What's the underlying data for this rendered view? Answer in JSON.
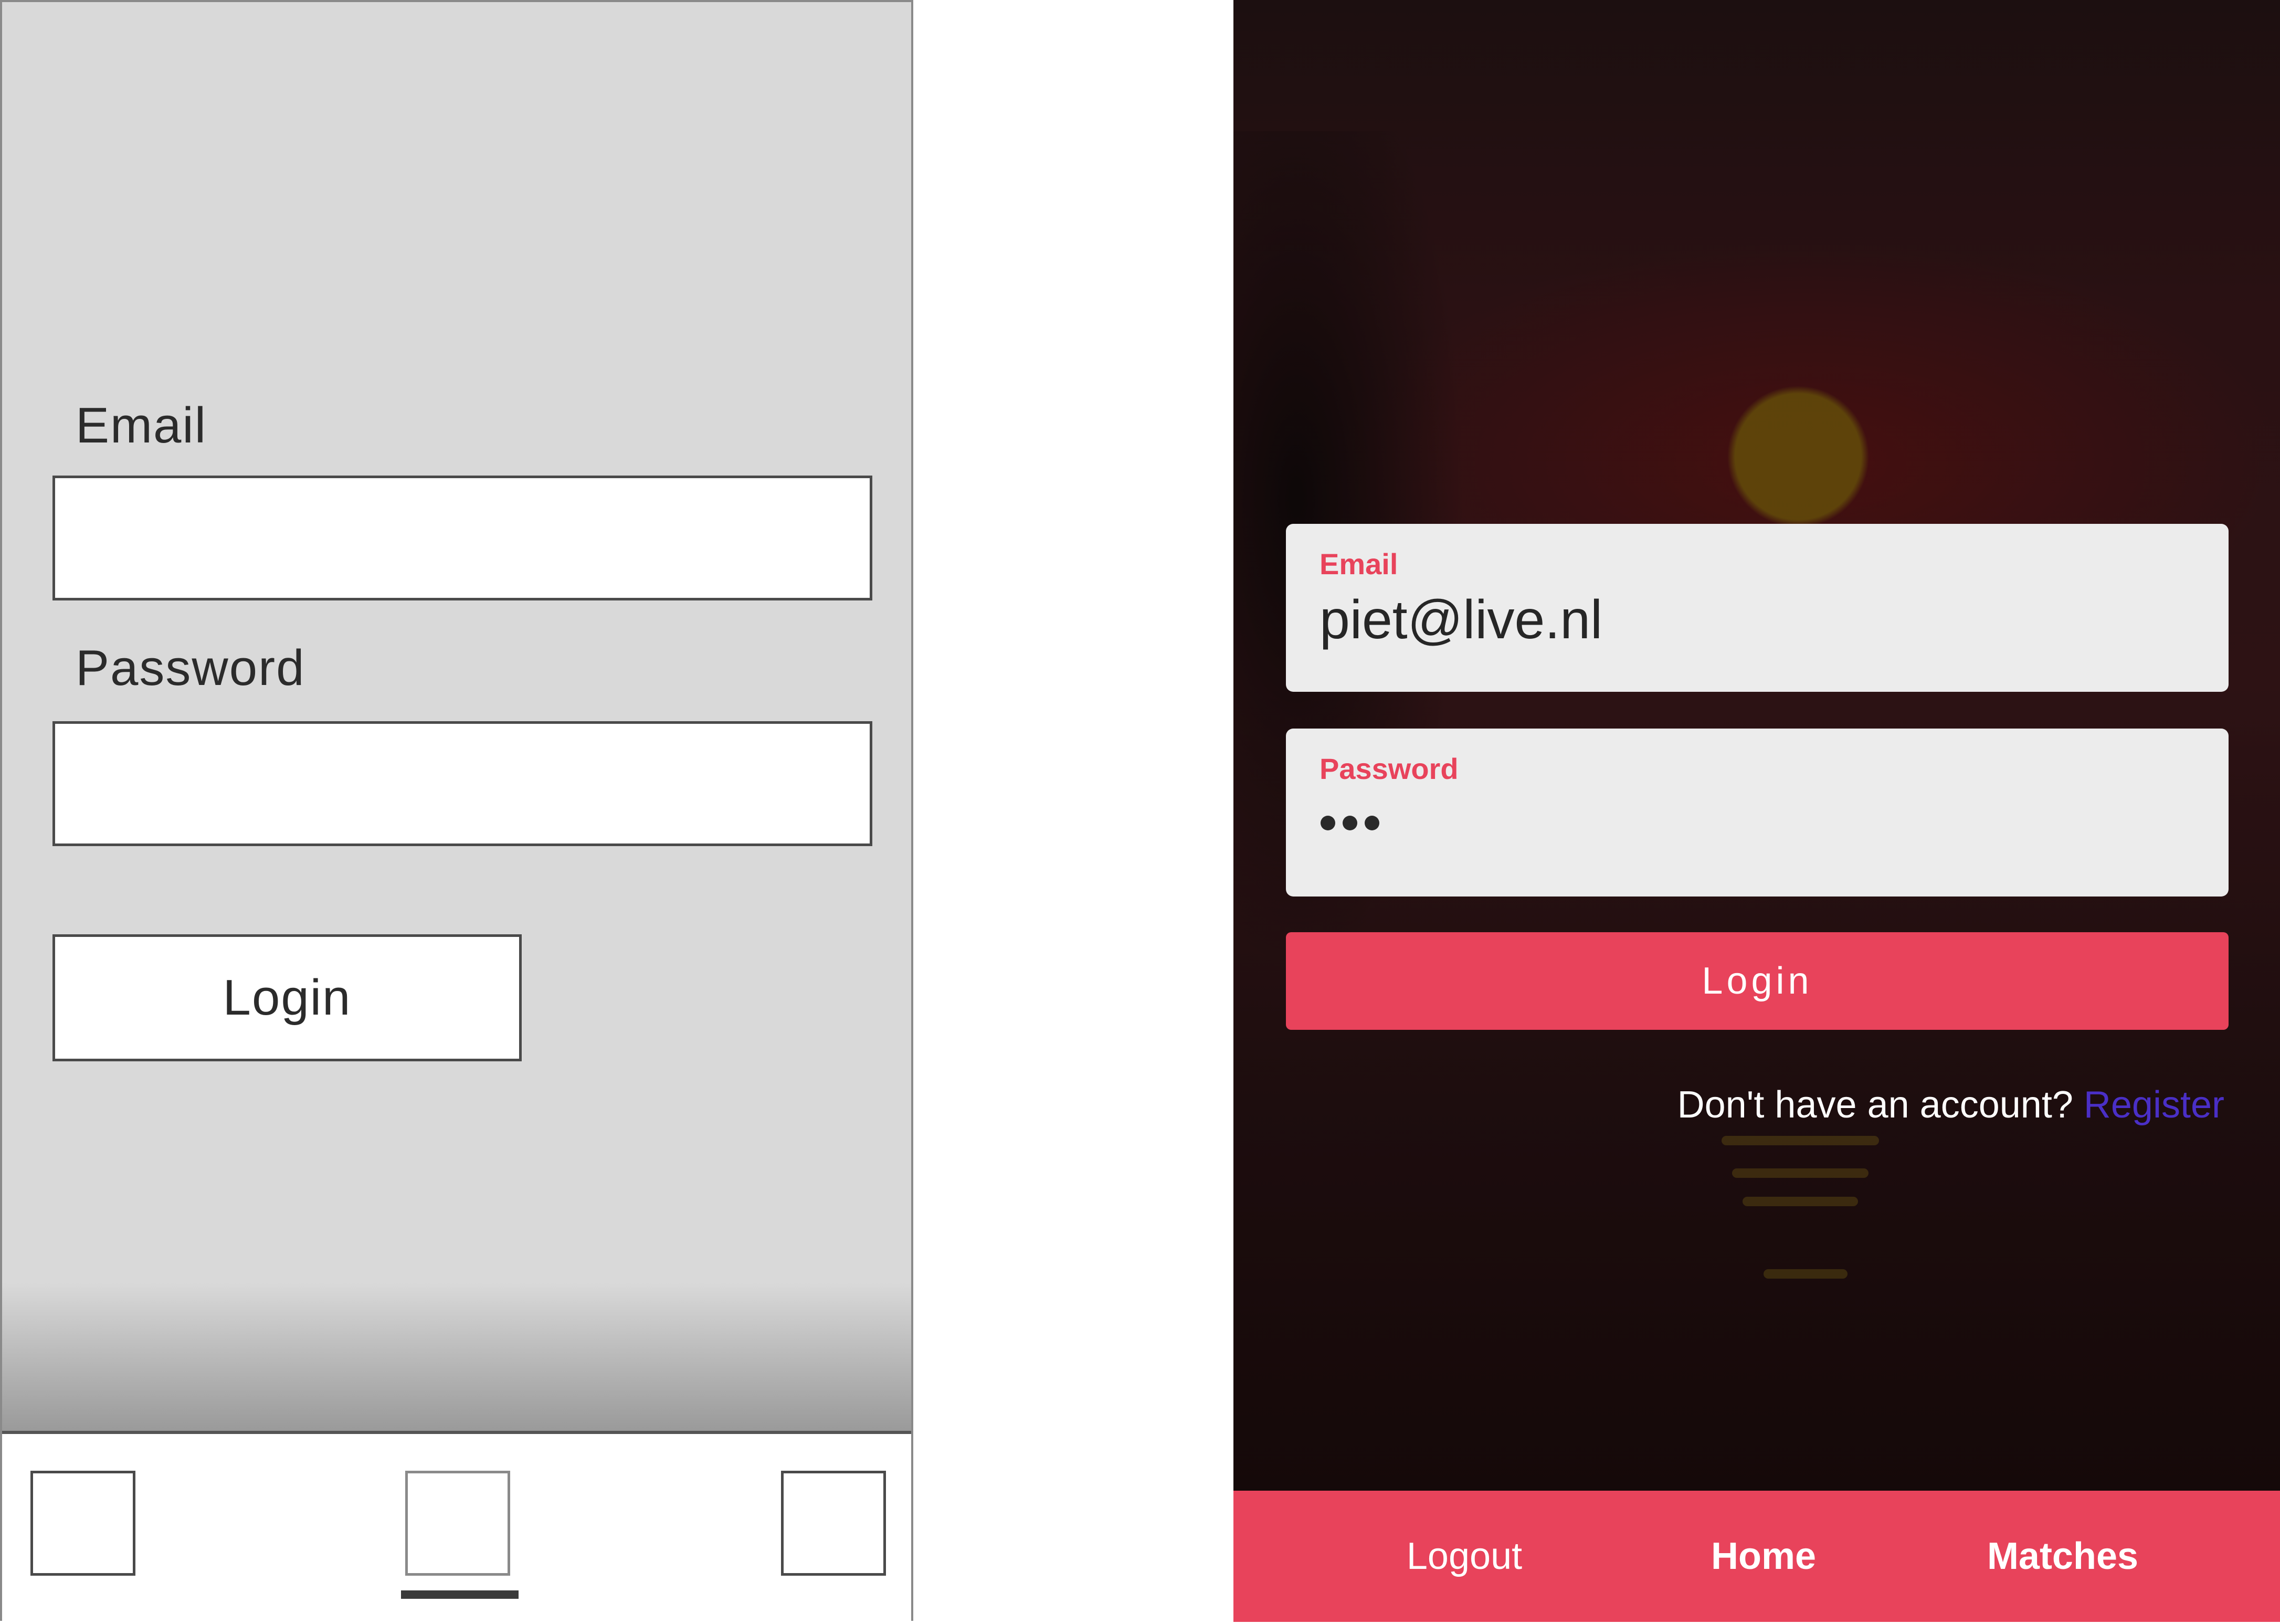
{
  "wireframe": {
    "email_label": "Email",
    "password_label": "Password",
    "login_button": "Login",
    "tabs": [
      "tab-left",
      "tab-center",
      "tab-right"
    ],
    "active_tab": "tab-center"
  },
  "app": {
    "email": {
      "label": "Email",
      "value": "piet@live.nl"
    },
    "password": {
      "label": "Password",
      "masked_length": 3
    },
    "login_button": "Login",
    "register_prompt": "Don't have an account?",
    "register_link": "Register",
    "nav": {
      "logout": "Logout",
      "home": "Home",
      "matches": "Matches"
    },
    "colors": {
      "accent": "#e8435b",
      "link": "#4a2fc6",
      "field_bg": "#ececec"
    }
  }
}
